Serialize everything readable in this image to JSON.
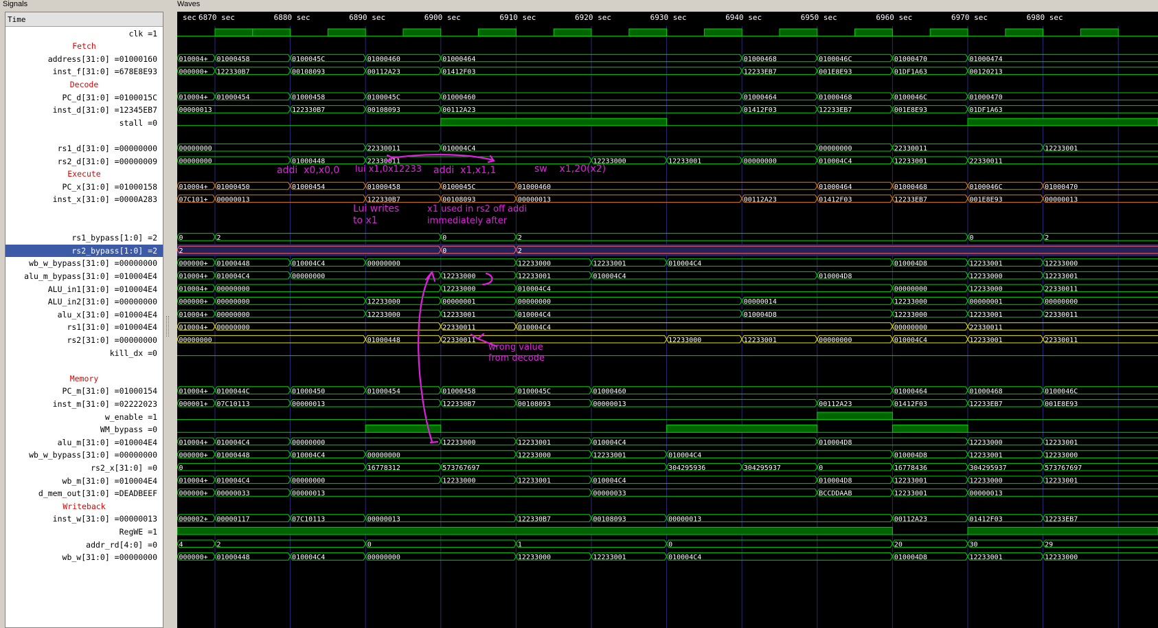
{
  "panels": {
    "signals_title": "Signals",
    "waves_title": "Waves",
    "time_label": "Time"
  },
  "ruler": [
    "sec",
    "6870 sec",
    "6880 sec",
    "6890 sec",
    "6900 sec",
    "6910 sec",
    "6920 sec",
    "6930 sec",
    "6940 sec",
    "6950 sec",
    "6960 sec",
    "6970 sec",
    "6980 sec"
  ],
  "signals": [
    {
      "label": "clk =1",
      "type": "clock"
    },
    {
      "label": "Fetch",
      "group": true
    },
    {
      "label": "address[31:0] =01000160",
      "color": "green",
      "segs": [
        [
          "010004+",
          0
        ],
        [
          "01000458",
          1
        ],
        [
          "0100045C",
          2
        ],
        [
          "01000460",
          3
        ],
        [
          "01000464",
          4
        ],
        [
          "01000468",
          8
        ],
        [
          "0100046C",
          9
        ],
        [
          "01000470",
          10
        ],
        [
          "01000474",
          11
        ]
      ]
    },
    {
      "label": "inst_f[31:0] =678E8E93",
      "color": "green",
      "segs": [
        [
          "000000+",
          0
        ],
        [
          "122330B7",
          1
        ],
        [
          "00108093",
          2
        ],
        [
          "00112A23",
          3
        ],
        [
          "01412F03",
          4
        ],
        [
          "12233EB7",
          8
        ],
        [
          "001E8E93",
          9
        ],
        [
          "01DF1A63",
          10
        ],
        [
          "00120213",
          11
        ]
      ]
    },
    {
      "label": "Decode",
      "group": true
    },
    {
      "label": "PC_d[31:0] =0100015C",
      "color": "green",
      "segs": [
        [
          "010004+",
          0
        ],
        [
          "01000454",
          1
        ],
        [
          "01000458",
          2
        ],
        [
          "0100045C",
          3
        ],
        [
          "01000460",
          4
        ],
        [
          "01000464",
          8
        ],
        [
          "01000468",
          9
        ],
        [
          "0100046C",
          10
        ],
        [
          "01000470",
          11
        ]
      ]
    },
    {
      "label": "inst_d[31:0] =12345EB7",
      "color": "green",
      "segs": [
        [
          "00000013",
          0
        ],
        [
          "122330B7",
          2
        ],
        [
          "00108093",
          3
        ],
        [
          "00112A23",
          4
        ],
        [
          "01412F03",
          8
        ],
        [
          "12233EB7",
          9
        ],
        [
          "001E8E93",
          10
        ],
        [
          "01DF1A63",
          11
        ]
      ]
    },
    {
      "label": "stall =0",
      "type": "bit",
      "high": [
        [
          4,
          7
        ],
        [
          11,
          13
        ]
      ]
    },
    {
      "label": "",
      "type": "blank"
    },
    {
      "label": "rs1_d[31:0] =00000000",
      "color": "green",
      "segs": [
        [
          "00000000",
          0
        ],
        [
          "22330011",
          3
        ],
        [
          "010004C4",
          4
        ],
        [
          "00000000",
          9
        ],
        [
          "22330011",
          10
        ],
        [
          "12233001",
          12
        ]
      ]
    },
    {
      "label": "rs2_d[31:0] =00000009",
      "color": "green",
      "segs": [
        [
          "00000000",
          0
        ],
        [
          "01000448",
          2
        ],
        [
          "22330011",
          3
        ],
        [
          "12233000",
          6
        ],
        [
          "12233001",
          7
        ],
        [
          "00000000",
          8
        ],
        [
          "010004C4",
          9
        ],
        [
          "12233001",
          10
        ],
        [
          "22330011",
          11
        ]
      ]
    },
    {
      "label": "Execute",
      "group": true
    },
    {
      "label": "PC_x[31:0] =01000158",
      "color": "orange",
      "segs": [
        [
          "010004+",
          0
        ],
        [
          "01000450",
          1
        ],
        [
          "01000454",
          2
        ],
        [
          "01000458",
          3
        ],
        [
          "0100045C",
          4
        ],
        [
          "01000460",
          5
        ],
        [
          "01000464",
          9
        ],
        [
          "01000468",
          10
        ],
        [
          "0100046C",
          11
        ],
        [
          "01000470",
          12
        ]
      ]
    },
    {
      "label": "inst_x[31:0] =0000A283",
      "color": "orange",
      "segs": [
        [
          "07C101+",
          0
        ],
        [
          "00000013",
          1
        ],
        [
          "122330B7",
          3
        ],
        [
          "00108093",
          4
        ],
        [
          "00000013",
          5
        ],
        [
          "00112A23",
          8
        ],
        [
          "01412F03",
          9
        ],
        [
          "12233EB7",
          10
        ],
        [
          "001E8E93",
          11
        ],
        [
          "00000013",
          12
        ]
      ]
    },
    {
      "label": "",
      "type": "blank"
    },
    {
      "label": "",
      "type": "blank"
    },
    {
      "label": "rs1_bypass[1:0] =2",
      "color": "green",
      "segs": [
        [
          "0",
          0
        ],
        [
          "2",
          1
        ],
        [
          "0",
          4
        ],
        [
          "2",
          5
        ],
        [
          "0",
          11
        ],
        [
          "2",
          12
        ]
      ]
    },
    {
      "label": "rs2_bypass[1:0] =2",
      "color": "pink",
      "selected": true,
      "segs": [
        [
          "2",
          0
        ],
        [
          "0",
          4
        ],
        [
          "2",
          5
        ]
      ]
    },
    {
      "label": "wb_w_bypass[31:0] =00000000",
      "color": "green",
      "segs": [
        [
          "000000+",
          0
        ],
        [
          "01000448",
          1
        ],
        [
          "010004C4",
          2
        ],
        [
          "00000000",
          3
        ],
        [
          "12233000",
          5
        ],
        [
          "12233001",
          6
        ],
        [
          "010004C4",
          7
        ],
        [
          "010004D8",
          10
        ],
        [
          "12233001",
          11
        ],
        [
          "12233000",
          12
        ]
      ]
    },
    {
      "label": "alu_m_bypass[31:0] =010004E4",
      "color": "green",
      "segs": [
        [
          "010004+",
          0
        ],
        [
          "010004C4",
          1
        ],
        [
          "00000000",
          2
        ],
        [
          "12233000",
          4
        ],
        [
          "12233001",
          5
        ],
        [
          "010004C4",
          6
        ],
        [
          "010004D8",
          9
        ],
        [
          "12233000",
          11
        ],
        [
          "12233001",
          12
        ]
      ]
    },
    {
      "label": "ALU_in1[31:0] =010004E4",
      "color": "green",
      "segs": [
        [
          "010004+",
          0
        ],
        [
          "00000000",
          1
        ],
        [
          "12233000",
          4
        ],
        [
          "010004C4",
          5
        ],
        [
          "00000000",
          10
        ],
        [
          "12233000",
          11
        ],
        [
          "22330011",
          12
        ]
      ]
    },
    {
      "label": "ALU_in2[31:0] =00000000",
      "color": "green",
      "segs": [
        [
          "000000+",
          0
        ],
        [
          "00000000",
          1
        ],
        [
          "12233000",
          3
        ],
        [
          "00000001",
          4
        ],
        [
          "00000000",
          5
        ],
        [
          "00000014",
          8
        ],
        [
          "12233000",
          10
        ],
        [
          "00000001",
          11
        ],
        [
          "00000000",
          12
        ]
      ]
    },
    {
      "label": "alu_x[31:0] =010004E4",
      "color": "green",
      "segs": [
        [
          "010004+",
          0
        ],
        [
          "00000000",
          1
        ],
        [
          "12233000",
          3
        ],
        [
          "12233001",
          4
        ],
        [
          "010004C4",
          5
        ],
        [
          "010004D8",
          8
        ],
        [
          "12233000",
          10
        ],
        [
          "12233001",
          11
        ],
        [
          "22330011",
          12
        ]
      ]
    },
    {
      "label": "rs1[31:0] =010004E4",
      "color": "yellow",
      "segs": [
        [
          "010004+",
          0
        ],
        [
          "00000000",
          1
        ],
        [
          "22330011",
          4
        ],
        [
          "010004C4",
          5
        ],
        [
          "00000000",
          10
        ],
        [
          "22330011",
          11
        ]
      ]
    },
    {
      "label": "rs2[31:0] =00000000",
      "color": "yellow",
      "segs": [
        [
          "00000000",
          0
        ],
        [
          "01000448",
          3
        ],
        [
          "22330011",
          4
        ],
        [
          "12233000",
          7
        ],
        [
          "12233001",
          8
        ],
        [
          "00000000",
          9
        ],
        [
          "010004C4",
          10
        ],
        [
          "12233001",
          11
        ],
        [
          "22330011",
          12
        ]
      ]
    },
    {
      "label": "kill_dx =0",
      "type": "bit",
      "high": []
    },
    {
      "label": "",
      "type": "blank"
    },
    {
      "label": "Memory",
      "group": true
    },
    {
      "label": "PC_m[31:0] =01000154",
      "color": "green",
      "segs": [
        [
          "010004+",
          0
        ],
        [
          "0100044C",
          1
        ],
        [
          "01000450",
          2
        ],
        [
          "01000454",
          3
        ],
        [
          "01000458",
          4
        ],
        [
          "0100045C",
          5
        ],
        [
          "01000460",
          6
        ],
        [
          "01000464",
          10
        ],
        [
          "01000468",
          11
        ],
        [
          "0100046C",
          12
        ]
      ]
    },
    {
      "label": "inst_m[31:0] =02222023",
      "color": "green",
      "segs": [
        [
          "000001+",
          0
        ],
        [
          "07C10113",
          1
        ],
        [
          "00000013",
          2
        ],
        [
          "122330B7",
          4
        ],
        [
          "00108093",
          5
        ],
        [
          "00000013",
          6
        ],
        [
          "00112A23",
          9
        ],
        [
          "01412F03",
          10
        ],
        [
          "12233EB7",
          11
        ],
        [
          "001E8E93",
          12
        ]
      ]
    },
    {
      "label": "w_enable =1",
      "type": "bit",
      "high": [
        [
          9,
          10
        ]
      ]
    },
    {
      "label": "WM_bypass =0",
      "type": "bit",
      "high": [
        [
          3,
          4
        ],
        [
          7,
          9
        ],
        [
          10,
          11
        ]
      ]
    },
    {
      "label": "alu_m[31:0] =010004E4",
      "color": "green",
      "segs": [
        [
          "010004+",
          0
        ],
        [
          "010004C4",
          1
        ],
        [
          "00000000",
          2
        ],
        [
          "12233000",
          4
        ],
        [
          "12233001",
          5
        ],
        [
          "010004C4",
          6
        ],
        [
          "010004D8",
          9
        ],
        [
          "12233000",
          11
        ],
        [
          "12233001",
          12
        ]
      ]
    },
    {
      "label": "wb_w_bypass[31:0] =00000000",
      "color": "green",
      "segs": [
        [
          "000000+",
          0
        ],
        [
          "01000448",
          1
        ],
        [
          "010004C4",
          2
        ],
        [
          "00000000",
          3
        ],
        [
          "12233000",
          5
        ],
        [
          "12233001",
          6
        ],
        [
          "010004C4",
          7
        ],
        [
          "010004D8",
          10
        ],
        [
          "12233001",
          11
        ],
        [
          "12233000",
          12
        ]
      ]
    },
    {
      "label": "rs2_x[31:0] =0",
      "color": "green",
      "segs": [
        [
          "0",
          0
        ],
        [
          "16778312",
          3
        ],
        [
          "573767697",
          4
        ],
        [
          "304295936",
          7
        ],
        [
          "304295937",
          8
        ],
        [
          "0",
          9
        ],
        [
          "16778436",
          10
        ],
        [
          "304295937",
          11
        ],
        [
          "573767697",
          12
        ]
      ]
    },
    {
      "label": "wb_m[31:0] =010004E4",
      "color": "green",
      "segs": [
        [
          "010004+",
          0
        ],
        [
          "010004C4",
          1
        ],
        [
          "00000000",
          2
        ],
        [
          "12233000",
          4
        ],
        [
          "12233001",
          5
        ],
        [
          "010004C4",
          6
        ],
        [
          "010004D8",
          9
        ],
        [
          "12233001",
          10
        ],
        [
          "12233000",
          11
        ],
        [
          "12233001",
          12
        ]
      ]
    },
    {
      "label": "d_mem_out[31:0] =DEADBEEF",
      "color": "green",
      "segs": [
        [
          "000000+",
          0
        ],
        [
          "00000033",
          1
        ],
        [
          "00000013",
          2
        ],
        [
          "00000033",
          6
        ],
        [
          "BCCDDAAB",
          9
        ],
        [
          "12233001",
          10
        ],
        [
          "00000013",
          11
        ]
      ]
    },
    {
      "label": "Writeback",
      "group": true
    },
    {
      "label": "inst_w[31:0] =00000013",
      "color": "green",
      "segs": [
        [
          "000002+",
          0
        ],
        [
          "00000117",
          1
        ],
        [
          "07C10113",
          2
        ],
        [
          "00000013",
          3
        ],
        [
          "122330B7",
          5
        ],
        [
          "00108093",
          6
        ],
        [
          "00000013",
          7
        ],
        [
          "00112A23",
          10
        ],
        [
          "01412F03",
          11
        ],
        [
          "12233EB7",
          12
        ]
      ]
    },
    {
      "label": "RegWE =1",
      "type": "bit",
      "high": [
        [
          0,
          10
        ],
        [
          11,
          13
        ]
      ]
    },
    {
      "label": "addr_rd[4:0] =0",
      "color": "green",
      "segs": [
        [
          "4",
          0
        ],
        [
          "2",
          1
        ],
        [
          "0",
          3
        ],
        [
          "1",
          5
        ],
        [
          "0",
          7
        ],
        [
          "20",
          10
        ],
        [
          "30",
          11
        ],
        [
          "29",
          12
        ]
      ]
    },
    {
      "label": "wb_w[31:0] =00000000",
      "color": "green",
      "segs": [
        [
          "000000+",
          0
        ],
        [
          "01000448",
          1
        ],
        [
          "010004C4",
          2
        ],
        [
          "00000000",
          3
        ],
        [
          "12233000",
          5
        ],
        [
          "12233001",
          6
        ],
        [
          "010004C4",
          7
        ],
        [
          "010004D8",
          10
        ],
        [
          "12233001",
          11
        ],
        [
          "12233000",
          12
        ]
      ]
    }
  ],
  "annotations": {
    "addi1": "addi  x0,x0,0",
    "lui": "lui x1,0x12233",
    "addi2": "addi  x1,x1,1",
    "sw": "sw    x1,20(x2)",
    "lui_writes": "Lui writes\nto x1",
    "x1_used": "x1 used in rs2 off addi\nimmediately after",
    "wrong_value": "wrong value\nfrom decode"
  },
  "colors": {
    "green": "#00d000",
    "orange": "#e08000",
    "yellow": "#e8e800",
    "pink": "#ff6060",
    "annotation": "#e020e0"
  }
}
